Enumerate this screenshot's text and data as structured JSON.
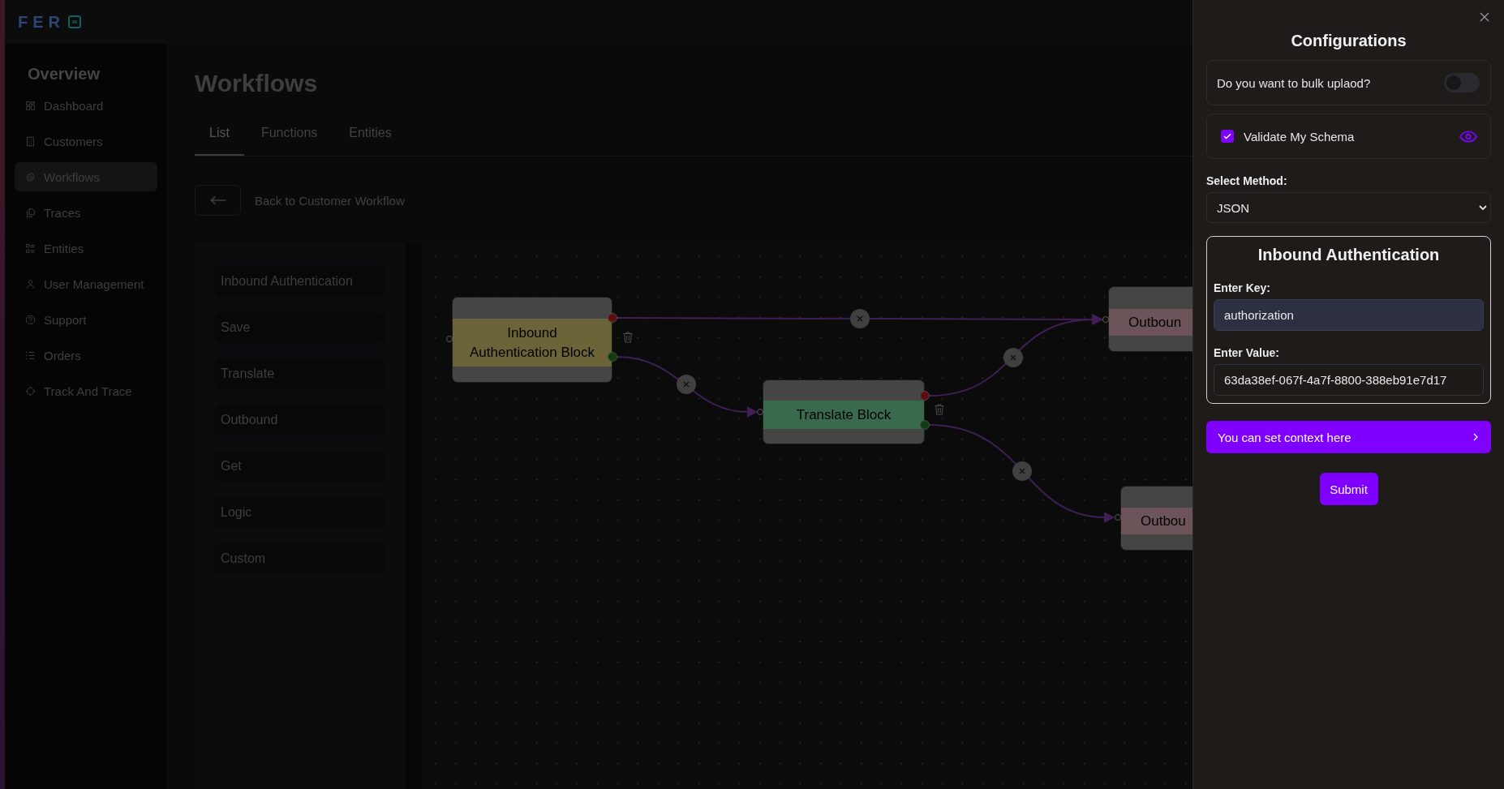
{
  "logo": {
    "text": "FER"
  },
  "sidebar": {
    "heading": "Overview",
    "items": [
      {
        "label": "Dashboard",
        "selected": false
      },
      {
        "label": "Customers",
        "selected": false
      },
      {
        "label": "Workflows",
        "selected": true
      },
      {
        "label": "Traces",
        "selected": false
      },
      {
        "label": "Entities",
        "selected": false
      },
      {
        "label": "User Management",
        "selected": false
      },
      {
        "label": "Support",
        "selected": false
      },
      {
        "label": "Orders",
        "selected": false
      },
      {
        "label": "Track And Trace",
        "selected": false
      }
    ]
  },
  "page": {
    "title": "Workflows",
    "tabs": [
      {
        "label": "List",
        "selected": true
      },
      {
        "label": "Functions",
        "selected": false
      },
      {
        "label": "Entities",
        "selected": false
      }
    ],
    "back_label": "Back to Customer Workflow"
  },
  "block_palette": {
    "items": [
      "Inbound Authentication",
      "Save",
      "Translate",
      "Outbound",
      "Get",
      "Logic",
      "Custom"
    ]
  },
  "canvas": {
    "nodes": [
      {
        "label": "Inbound Authentication Block",
        "color": "#6b6438"
      },
      {
        "label": "Translate Block",
        "color": "#3a6a4e"
      },
      {
        "label": "Outboun",
        "color": "#6c5459"
      },
      {
        "label": "Outbou",
        "color": "#6c5459"
      }
    ]
  },
  "config_panel": {
    "title": "Configurations",
    "bulk_upload": {
      "label": "Do you want to bulk uplaod?",
      "on": false
    },
    "validate_schema": {
      "label": "Validate My Schema",
      "checked": true
    },
    "method": {
      "label": "Select Method:",
      "value": "JSON"
    },
    "auth_section": {
      "title": "Inbound Authentication",
      "key_label": "Enter Key:",
      "key_value": "authorization",
      "value_label": "Enter Value:",
      "value_value": "63da38ef-067f-4a7f-8800-388eb91e7d17"
    },
    "context_button": "You can set context here",
    "submit_button": "Submit"
  }
}
